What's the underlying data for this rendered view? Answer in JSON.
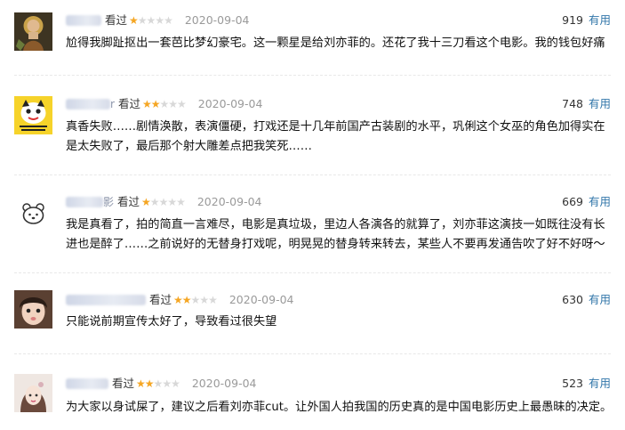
{
  "reviews": [
    {
      "user_tail": "",
      "watched_label": "看过",
      "rating": 1,
      "date": "2020-09-04",
      "votes": "919",
      "useful_label": "有用",
      "text": "尬得我脚趾抠出一套芭比梦幻豪宅。这一颗星是给刘亦菲的。还花了我十三刀看这个电影。我的钱包好痛",
      "avatar": "saint-portrait-avatar"
    },
    {
      "user_tail": "r",
      "watched_label": "看过",
      "rating": 2,
      "date": "2020-09-04",
      "votes": "748",
      "useful_label": "有用",
      "text": "真香失败……剧情涣散，表演僵硬，打戏还是十几年前国产古装剧的水平，巩俐这个女巫的角色加得实在是太失败了，最后那个射大雕差点把我笑死……",
      "avatar": "tiger-cartoon-avatar"
    },
    {
      "user_tail": "影",
      "watched_label": "看过",
      "rating": 1,
      "date": "2020-09-04",
      "votes": "669",
      "useful_label": "有用",
      "text": "我是真看了，拍的简直一言难尽，电影是真垃圾，里边人各演各的就算了，刘亦菲这演技一如既往没有长进也是醉了……之前说好的无替身打戏呢，明晃晃的替身转来转去，某些人不要再发通告吹了好不好呀～",
      "avatar": "bear-doodle-avatar"
    },
    {
      "user_tail": "",
      "watched_label": "看过",
      "rating": 2,
      "date": "2020-09-04",
      "votes": "630",
      "useful_label": "有用",
      "text": "只能说前期宣传太好了，导致看过很失望",
      "avatar": "child-photo-avatar"
    },
    {
      "user_tail": "",
      "watched_label": "看过",
      "rating": 2,
      "date": "2020-09-04",
      "votes": "523",
      "useful_label": "有用",
      "text": "为大家以身试屎了，建议之后看刘亦菲cut。让外国人拍我国的历史真的是中国电影历史上最愚昧的决定。",
      "avatar": "girl-illustration-avatar"
    }
  ],
  "colors": {
    "star_on": "#f5a623",
    "star_off": "#d8d8d8",
    "useful_link": "#3377aa",
    "date": "#9a9a9a"
  }
}
